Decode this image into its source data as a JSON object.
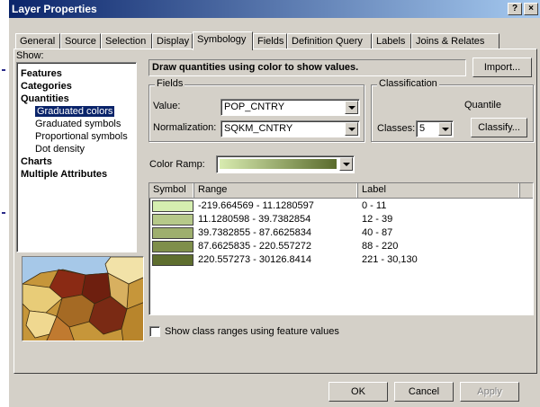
{
  "window": {
    "title": "Layer Properties",
    "help_button": "?",
    "close_button": "×"
  },
  "tabs": [
    "General",
    "Source",
    "Selection",
    "Display",
    "Symbology",
    "Fields",
    "Definition Query",
    "Labels",
    "Joins & Relates"
  ],
  "active_tab": "Symbology",
  "show": {
    "label": "Show:",
    "items": [
      {
        "label": "Features",
        "level": 0
      },
      {
        "label": "Categories",
        "level": 0
      },
      {
        "label": "Quantities",
        "level": 0
      },
      {
        "label": "Graduated colors",
        "level": 1,
        "selected": true
      },
      {
        "label": "Graduated symbols",
        "level": 1
      },
      {
        "label": "Proportional symbols",
        "level": 1
      },
      {
        "label": "Dot density",
        "level": 1
      },
      {
        "label": "Charts",
        "level": 0
      },
      {
        "label": "Multiple Attributes",
        "level": 0
      }
    ]
  },
  "header": {
    "description": "Draw quantities using color to show values.",
    "import_button": "Import..."
  },
  "fields": {
    "group_title": "Fields",
    "value_label": "Value:",
    "value": "POP_CNTRY",
    "normalization_label": "Normalization:",
    "normalization": "SQKM_CNTRY"
  },
  "classification": {
    "group_title": "Classification",
    "method": "Quantile",
    "classes_label": "Classes:",
    "classes": "5",
    "classify_button": "Classify..."
  },
  "color_ramp": {
    "label": "Color Ramp:",
    "start_color": "#d8ebb0",
    "end_color": "#5a6b2c"
  },
  "table": {
    "headers": [
      "Symbol",
      "Range",
      "Label"
    ],
    "rows": [
      {
        "color": "#d5eeb0",
        "range": "-219.664569 - 11.1280597",
        "label": "0 - 11"
      },
      {
        "color": "#b6c98a",
        "range": "11.1280598 - 39.7382854",
        "label": "12 - 39"
      },
      {
        "color": "#9eaf6e",
        "range": "39.7382855 - 87.6625834",
        "label": "40 - 87"
      },
      {
        "color": "#7f8f4a",
        "range": "87.6625835 - 220.557272",
        "label": "88 - 220"
      },
      {
        "color": "#5e6e2e",
        "range": "220.557273 - 30126.8414",
        "label": "221 - 30,130"
      }
    ]
  },
  "show_class_ranges": "Show class ranges using feature values",
  "buttons": {
    "ok": "OK",
    "cancel": "Cancel",
    "apply": "Apply"
  },
  "colors": {
    "title_start": "#0a246a",
    "title_end": "#a6caf0",
    "face": "#d4d0c8",
    "selection": "#0a246a"
  }
}
